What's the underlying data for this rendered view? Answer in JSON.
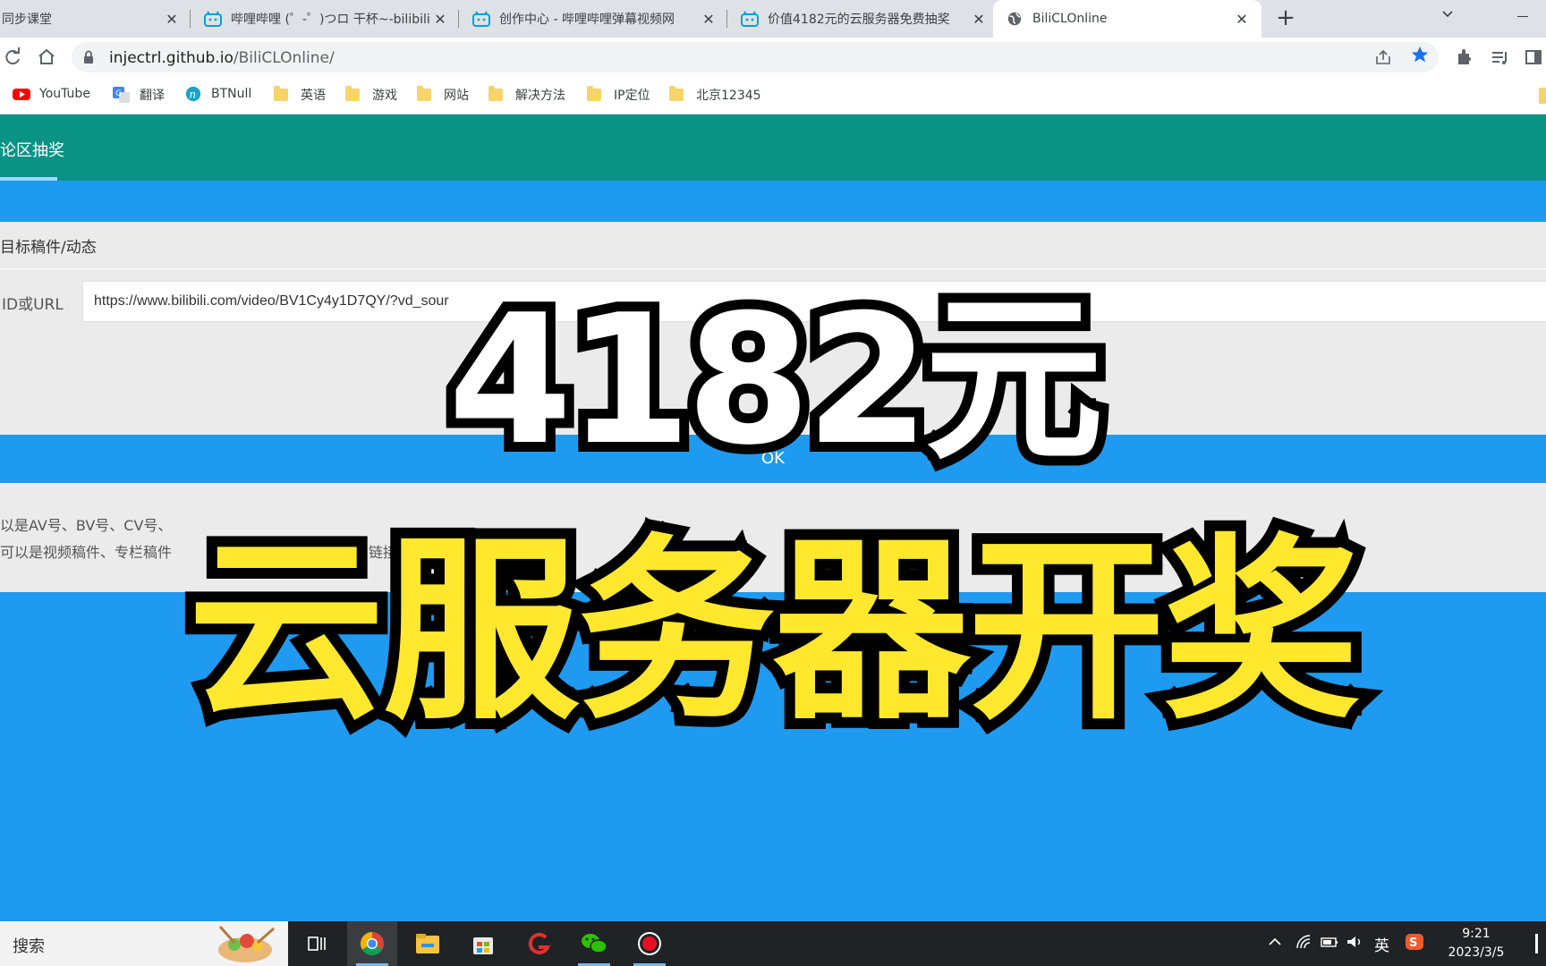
{
  "browser": {
    "tabs": [
      {
        "title": "同步课堂",
        "active": false
      },
      {
        "title": "哔哩哔哩 (゜-゜)つロ 干杯~-bilibili",
        "active": false
      },
      {
        "title": "创作中心 - 哔哩哔哩弹幕视频网",
        "active": false
      },
      {
        "title": "价值4182元的云服务器免费抽奖",
        "active": false
      },
      {
        "title": "BiliCLOnline",
        "active": true
      }
    ],
    "close_glyph": "✕",
    "new_tab_glyph": "+",
    "url_host": "injectrl.github.io",
    "url_path": "/BiliCLOnline/",
    "bookmarks": [
      {
        "label": "YouTube",
        "icon": "youtube-icon"
      },
      {
        "label": "翻译",
        "icon": "translate-icon"
      },
      {
        "label": "BTNull",
        "icon": "btnull-icon"
      },
      {
        "label": "英语",
        "icon": "folder-icon"
      },
      {
        "label": "游戏",
        "icon": "folder-icon"
      },
      {
        "label": "网站",
        "icon": "folder-icon"
      },
      {
        "label": "解决方法",
        "icon": "folder-icon"
      },
      {
        "label": "IP定位",
        "icon": "folder-icon"
      },
      {
        "label": "北京12345",
        "icon": "folder-icon"
      }
    ]
  },
  "app": {
    "nav_tab": "论区抽奖",
    "card_title": "目标稿件/动态",
    "field_label": "ID或URL",
    "field_value": "https://www.bilibili.com/video/BV1Cy4y1D7QY/?vd_sour",
    "ok_label": "OK",
    "hints": [
      "以是AV号、BV号、CV号、",
      "可以是视频稿件、专栏稿件",
      "链接"
    ]
  },
  "overlay": {
    "headline_top": "4182元",
    "headline_bottom": "云服务器开奖"
  },
  "taskbar": {
    "search_label": "搜索",
    "ime_label": "英",
    "time": "9:21",
    "date": "2023/3/5"
  },
  "colors": {
    "app_bar": "#0a9285",
    "page_blue": "#1e9bf0",
    "headline_yellow": "#ffe82e",
    "headline_white": "#ffffff"
  }
}
